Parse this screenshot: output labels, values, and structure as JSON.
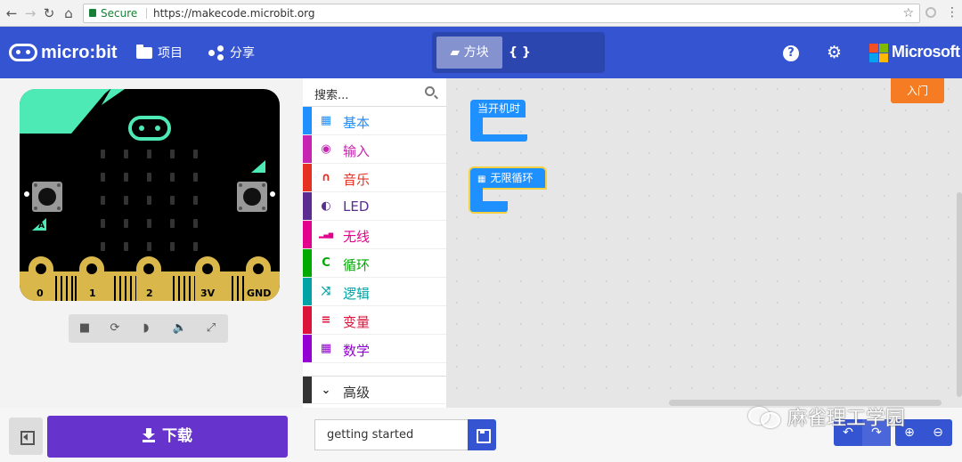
{
  "browser": {
    "security_label": "Secure",
    "url": "https://makecode.microbit.org"
  },
  "header": {
    "logo_text": "micro:bit",
    "projects_label": "项目",
    "share_label": "分享",
    "blocks_label": "方块",
    "javascript_label": "{ } JavaScript",
    "help_icon": "?",
    "brand": "Microsoft"
  },
  "simulator": {
    "button_a": "A",
    "button_b": "B",
    "pins": [
      "0",
      "1",
      "2",
      "3V",
      "GND"
    ]
  },
  "toolbox": {
    "search_placeholder": "搜索...",
    "categories": [
      {
        "label": "基本",
        "color": "#1e90ff",
        "icon": "grid-icon"
      },
      {
        "label": "输入",
        "color": "#c724b1",
        "icon": "target-icon"
      },
      {
        "label": "音乐",
        "color": "#e63022",
        "icon": "headphones-icon"
      },
      {
        "label": "LED",
        "color": "#5c2d91",
        "icon": "toggle-icon"
      },
      {
        "label": "无线",
        "color": "#e3008c",
        "icon": "signal-icon"
      },
      {
        "label": "循环",
        "color": "#00aa00",
        "icon": "refresh-icon"
      },
      {
        "label": "逻辑",
        "color": "#00a4a6",
        "icon": "shuffle-icon"
      },
      {
        "label": "变量",
        "color": "#dc143c",
        "icon": "list-icon"
      },
      {
        "label": "数学",
        "color": "#9400d3",
        "icon": "calculator-icon"
      },
      {
        "label": "高级",
        "color": "#333333",
        "icon": "chevron-down-icon"
      }
    ]
  },
  "workspace": {
    "tutorial_label": "入门",
    "block_on_start": "当开机时",
    "block_forever": "无限循环"
  },
  "bottom": {
    "download_label": "下载",
    "project_name": "getting started"
  },
  "watermark": "麻雀理工学园"
}
